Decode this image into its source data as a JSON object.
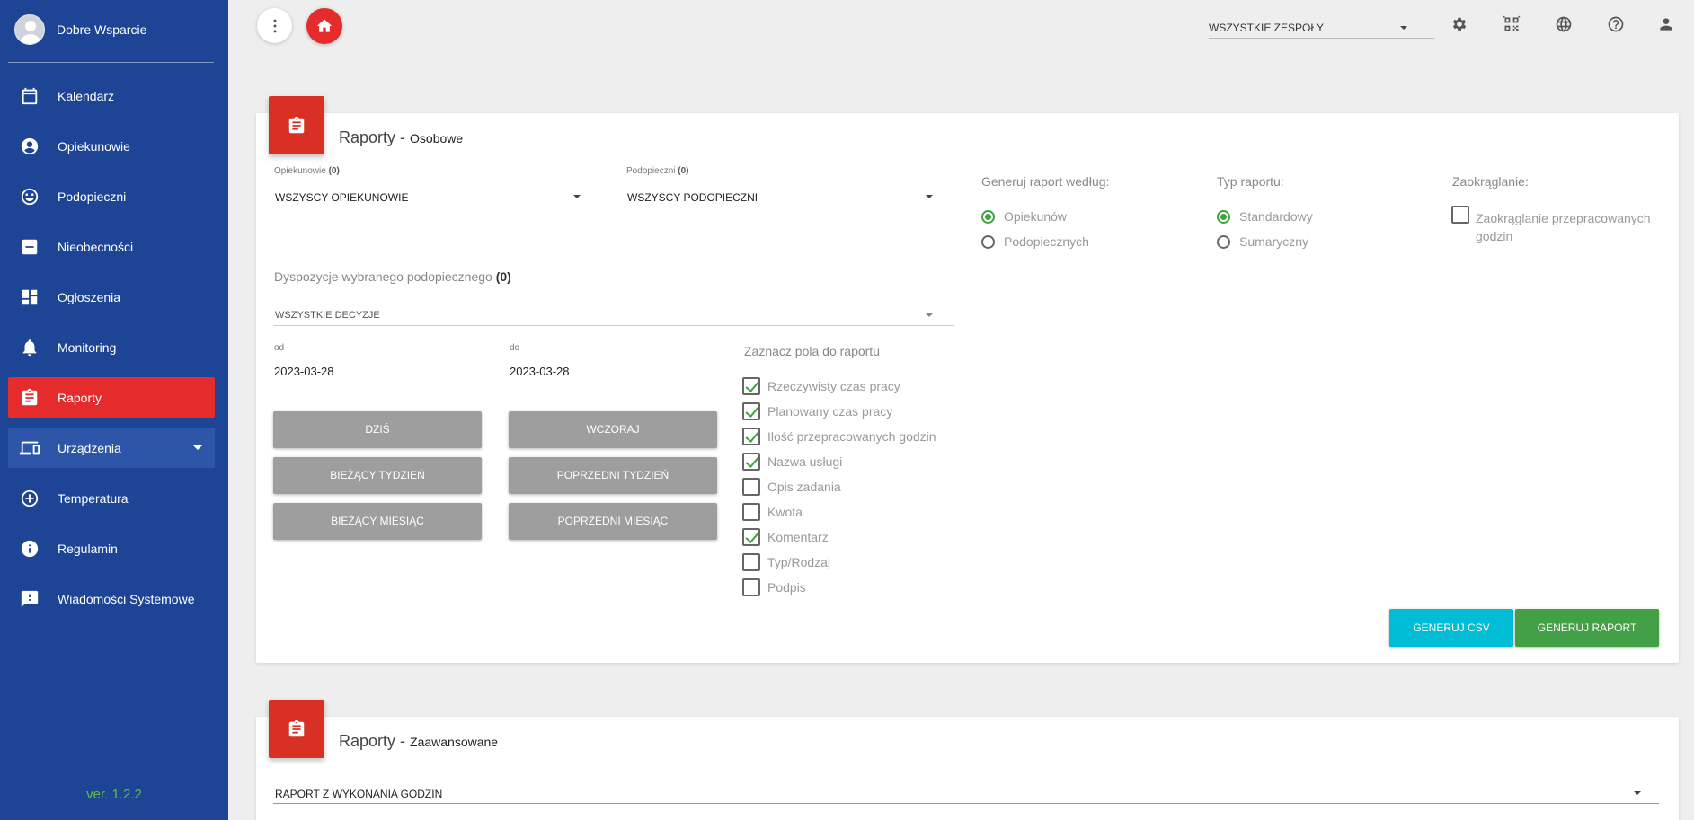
{
  "sidebar": {
    "user_name": "Dobre Wsparcie",
    "items": [
      {
        "label": "Kalendarz",
        "icon": "calendar-icon"
      },
      {
        "label": "Opiekunowie",
        "icon": "account-circle-icon"
      },
      {
        "label": "Podopieczni",
        "icon": "smile-icon"
      },
      {
        "label": "Nieobecności",
        "icon": "minus-box-icon"
      },
      {
        "label": "Ogłoszenia",
        "icon": "dashboard-icon"
      },
      {
        "label": "Monitoring",
        "icon": "bell-icon"
      },
      {
        "label": "Raporty",
        "icon": "clipboard-icon",
        "active": true
      },
      {
        "label": "Urządzenia",
        "icon": "devices-icon"
      },
      {
        "label": "Temperatura",
        "icon": "plus-circle-icon"
      },
      {
        "label": "Regulamin",
        "icon": "info-icon"
      },
      {
        "label": "Wiadomości Systemowe",
        "icon": "feedback-icon"
      }
    ],
    "version": "ver. 1.2.2",
    "colors": {
      "background": "#1e4496",
      "active": "#e52b2b",
      "version": "#5fbf3e"
    }
  },
  "topbar": {
    "team_select": "WSZYSTKIE ZESPOŁY",
    "icons": [
      "settings-icon",
      "qr-code-icon",
      "globe-icon",
      "help-icon",
      "person-icon"
    ]
  },
  "personal_report": {
    "title": "Raporty",
    "subtitle": "Osobowe",
    "caregivers_label": "Opiekunowie",
    "caregivers_count": "(0)",
    "caregivers_value": "WSZYSCY OPIEKUNOWIE",
    "wards_label": "Podopieczni",
    "wards_count": "(0)",
    "wards_value": "WSZYSCY PODOPIECZNI",
    "dispositions_label": "Dyspozycje wybranego podopiecznego",
    "dispositions_count": "(0)",
    "dispositions_value": "WSZYSTKIE DECYZJE",
    "from_label": "od",
    "from_value": "2023-03-28",
    "to_label": "do",
    "to_value": "2023-03-28",
    "buttons": {
      "today": "DZIŚ",
      "yesterday": "WCZORAJ",
      "current_week": "BIEŻĄCY TYDZIEŃ",
      "previous_week": "POPRZEDNI TYDZIEŃ",
      "current_month": "BIEŻĄCY MIESIĄC",
      "previous_month": "POPRZEDNI MIESIĄC"
    },
    "fields_label": "Zaznacz pola do raportu",
    "fields": [
      {
        "label": "Rzeczywisty czas pracy",
        "checked": true
      },
      {
        "label": "Planowany czas pracy",
        "checked": true
      },
      {
        "label": "Ilość przepracowanych godzin",
        "checked": true
      },
      {
        "label": "Nazwa usługi",
        "checked": true
      },
      {
        "label": "Opis zadania",
        "checked": false
      },
      {
        "label": "Kwota",
        "checked": false
      },
      {
        "label": "Komentarz",
        "checked": true
      },
      {
        "label": "Typ/Rodzaj",
        "checked": false
      },
      {
        "label": "Podpis",
        "checked": false
      }
    ],
    "generate_by_label": "Generuj raport według:",
    "generate_by_options": [
      {
        "label": "Opiekunów",
        "selected": true
      },
      {
        "label": "Podopiecznych",
        "selected": false
      }
    ],
    "report_type_label": "Typ raportu:",
    "report_type_options": [
      {
        "label": "Standardowy",
        "selected": true
      },
      {
        "label": "Sumaryczny",
        "selected": false
      }
    ],
    "rounding_label": "Zaokrąglanie:",
    "rounding_option": "Zaokrąglanie przepracowanych godzin",
    "rounding_checked": false,
    "csv_button": "GENERUJ CSV",
    "report_button": "GENERUJ RAPORT",
    "colors": {
      "csv": "#00bcd4",
      "report": "#43a047",
      "check": "#3da33d"
    }
  },
  "advanced_report": {
    "title": "Raporty",
    "subtitle": "Zaawansowane",
    "select_value": "RAPORT Z WYKONANIA GODZIN"
  }
}
